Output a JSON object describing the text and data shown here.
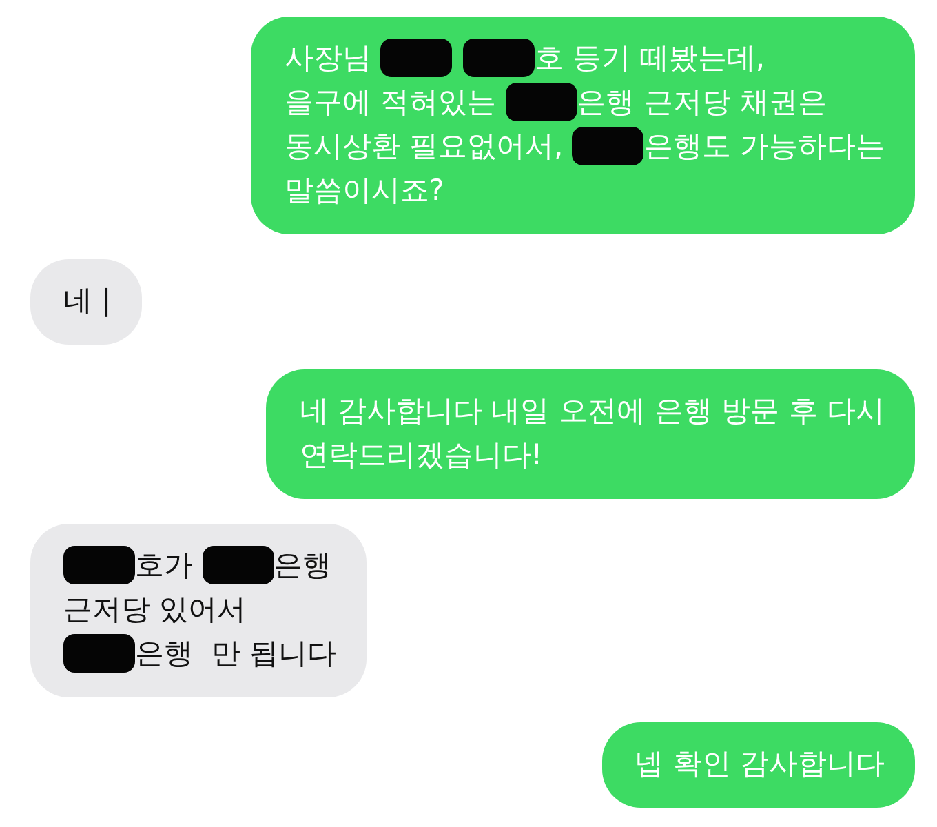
{
  "messages": [
    {
      "kind": "sent",
      "lines": [
        [
          {
            "kind": "text",
            "text": "사장님 "
          },
          {
            "kind": "redaction"
          },
          {
            "kind": "redaction"
          },
          {
            "kind": "text",
            "text": "호 등기 떼봤는데,"
          }
        ],
        [
          {
            "kind": "text",
            "text": "을구에 적혀있는 "
          },
          {
            "kind": "redaction"
          },
          {
            "kind": "text",
            "text": "은행 근저당 채권은"
          }
        ],
        [
          {
            "kind": "text",
            "text": "동시상환 필요없어서, "
          },
          {
            "kind": "redaction"
          },
          {
            "kind": "text",
            "text": "은행도 가능하다는"
          }
        ],
        [
          {
            "kind": "text",
            "text": "말씀이시죠?"
          }
        ]
      ]
    },
    {
      "kind": "received",
      "lines": [
        [
          {
            "kind": "text",
            "text": "네 |"
          }
        ]
      ]
    },
    {
      "kind": "sent",
      "lines": [
        [
          {
            "kind": "text",
            "text": "네 감사합니다 내일 오전에 은행 방문 후 다시"
          }
        ],
        [
          {
            "kind": "text",
            "text": "연락드리겠습니다!"
          }
        ]
      ]
    },
    {
      "kind": "received",
      "lines": [
        [
          {
            "kind": "redaction"
          },
          {
            "kind": "text",
            "text": "호가 "
          },
          {
            "kind": "redaction"
          },
          {
            "kind": "text",
            "text": "은행"
          }
        ],
        [
          {
            "kind": "text",
            "text": "근저당 있어서"
          }
        ],
        [
          {
            "kind": "redaction"
          },
          {
            "kind": "text",
            "text": "은행  만 됩니다"
          }
        ]
      ]
    },
    {
      "kind": "sent",
      "lines": [
        [
          {
            "kind": "text",
            "text": "넵 확인 감사합니다"
          }
        ]
      ]
    }
  ]
}
